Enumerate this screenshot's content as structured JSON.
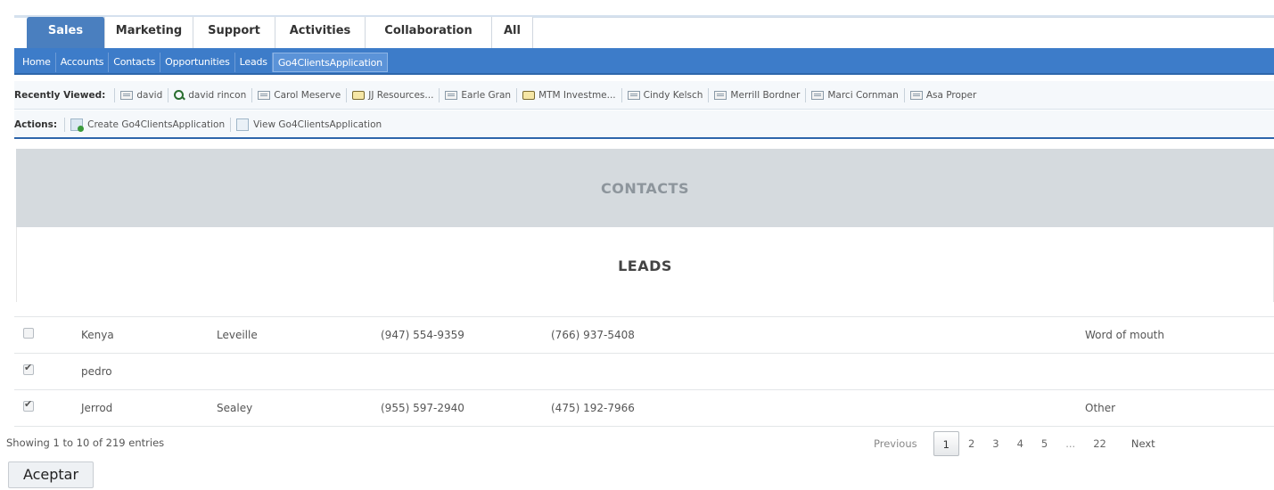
{
  "module_tabs": [
    {
      "label": "Sales",
      "active": true
    },
    {
      "label": "Marketing",
      "active": false
    },
    {
      "label": "Support",
      "active": false
    },
    {
      "label": "Activities",
      "active": false
    },
    {
      "label": "Collaboration",
      "active": false
    },
    {
      "label": "All",
      "active": false
    }
  ],
  "subnav": [
    "Home",
    "Accounts",
    "Contacts",
    "Opportunities",
    "Leads",
    "Go4ClientsApplication"
  ],
  "recently_viewed": {
    "title": "Recently Viewed:",
    "items": [
      {
        "label": "david",
        "icon": "contact-icon"
      },
      {
        "label": "david rincon",
        "icon": "search-icon"
      },
      {
        "label": "Carol Meserve",
        "icon": "contact-icon"
      },
      {
        "label": "JJ Resources...",
        "icon": "account-icon"
      },
      {
        "label": "Earle Gran",
        "icon": "contact-icon"
      },
      {
        "label": "MTM Investme...",
        "icon": "account-icon"
      },
      {
        "label": "Cindy Kelsch",
        "icon": "contact-icon"
      },
      {
        "label": "Merrill Bordner",
        "icon": "contact-icon"
      },
      {
        "label": "Marci Cornman",
        "icon": "contact-icon"
      },
      {
        "label": "Asa Proper",
        "icon": "contact-icon"
      }
    ]
  },
  "actions": {
    "title": "Actions:",
    "items": [
      {
        "label": "Create Go4ClientsApplication",
        "icon": "create-icon"
      },
      {
        "label": "View Go4ClientsApplication",
        "icon": "view-icon"
      }
    ]
  },
  "sections": {
    "contacts": "CONTACTS",
    "leads": "LEADS"
  },
  "leads_rows": [
    {
      "checked": false,
      "first": "Kenya",
      "last": "Leveille",
      "phone1": "(947) 554-9359",
      "phone2": "(766) 937-5408",
      "source": "Word of mouth"
    },
    {
      "checked": true,
      "first": "pedro",
      "last": "",
      "phone1": "",
      "phone2": "",
      "source": ""
    },
    {
      "checked": true,
      "first": "Jerrod",
      "last": "Sealey",
      "phone1": "(955) 597-2940",
      "phone2": "(475) 192-7966",
      "source": "Other"
    }
  ],
  "table_info": "Showing 1 to 10 of 219 entries",
  "pagination": {
    "previous": "Previous",
    "pages": [
      "1",
      "2",
      "3",
      "4",
      "5",
      "...",
      "22"
    ],
    "current": "1",
    "next": "Next"
  },
  "accept_button": "Aceptar",
  "colors": {
    "primary_blue": "#3d7cc9",
    "active_tab": "#4a7fbf",
    "section_gray": "#d5dade"
  }
}
